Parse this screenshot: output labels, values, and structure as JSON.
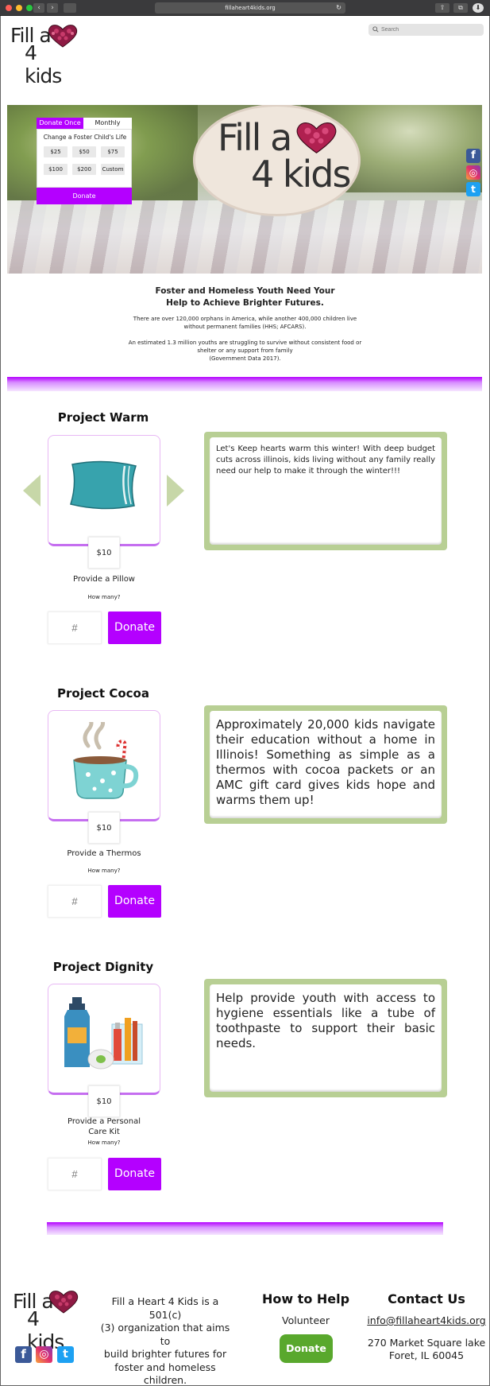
{
  "browser": {
    "url": "fillaheart4kids.org",
    "back_glyph": "‹",
    "forward_glyph": "›",
    "reload_glyph": "↻",
    "share_glyph": "⇧",
    "tabs_glyph": "⧉",
    "downloads_glyph": "⬇"
  },
  "header": {
    "logo_line1": "Fill a",
    "logo_line2": "4 kids",
    "search_placeholder": "Search"
  },
  "hero": {
    "sign_line1": "Fill a",
    "sign_line2": "4 kids",
    "donate_widget": {
      "tab_once": "Donate Once",
      "tab_monthly": "Monthly",
      "heading": "Change a Foster Child's Life",
      "amounts": [
        "$25",
        "$50",
        "$75",
        "$100",
        "$200",
        "Custom"
      ],
      "donate_label": "Donate"
    },
    "social": {
      "facebook": "f",
      "instagram": "◎",
      "twitter": "t"
    }
  },
  "intro": {
    "title_line1": "Foster and Homeless Youth Need Your",
    "title_line2": "Help to Achieve Brighter Futures.",
    "p1_line1": "There are over 120,000 orphans in America, while another 400,000 children live",
    "p1_line2": "without permanent families (HHS; AFCARS).",
    "p2_line1": "An estimated 1.3 million youths are struggling to survive without consistent food or",
    "p2_line2": "shelter or any support from family",
    "p2_line3": "(Government Data 2017)."
  },
  "projects": [
    {
      "title": "Project Warm",
      "price": "$10",
      "provide": "Provide a Pillow",
      "how_many": "How many?",
      "qty_placeholder": "#",
      "donate_label": "Donate",
      "description": "Let's Keep hearts warm this winter!  With deep budget cuts across illinois, kids living without any family really need our help to make it through the winter!!!"
    },
    {
      "title": "Project Cocoa",
      "price": "$10",
      "provide": "Provide a Thermos",
      "how_many": "How many?",
      "qty_placeholder": "#",
      "donate_label": "Donate",
      "description": "Approximately 20,000 kids navigate their education without a home in Illinois!  Something as simple as a thermos with cocoa packets or an AMC gift card gives kids hope and warms them up!"
    },
    {
      "title": "Project Dignity",
      "price": "$10",
      "provide_line1": "Provide a Personal",
      "provide_line2": "Care Kit",
      "how_many": "How many?",
      "qty_placeholder": "#",
      "donate_label": "Donate",
      "description": "Help provide youth with access to hygiene essentials like a tube of toothpaste to support their basic needs."
    }
  ],
  "footer": {
    "logo_line1": "Fill a",
    "logo_line2": "4 kids",
    "about_lines": [
      "Fill a Heart 4 Kids is a 501(c)",
      "(3) organization that aims to",
      "build brighter futures for",
      "foster and homeless",
      "children."
    ],
    "how_to_help": "How to Help",
    "volunteer": "Volunteer",
    "donate_label": "Donate",
    "contact_us": "Contact Us",
    "email": "info@fillaheart4kids.org",
    "address_line1": "270 Market Square lake",
    "address_line2": "Foret, IL 60045",
    "social": {
      "facebook": "f",
      "instagram": "◎",
      "twitter": "t"
    }
  },
  "colors": {
    "accent_purple": "#b400ff",
    "card_border": "#e8b8f4",
    "desc_green": "#b8cf94",
    "footer_donate_green": "#59a82d",
    "facebook_blue": "#3b5998",
    "twitter_blue": "#1da1f2"
  }
}
